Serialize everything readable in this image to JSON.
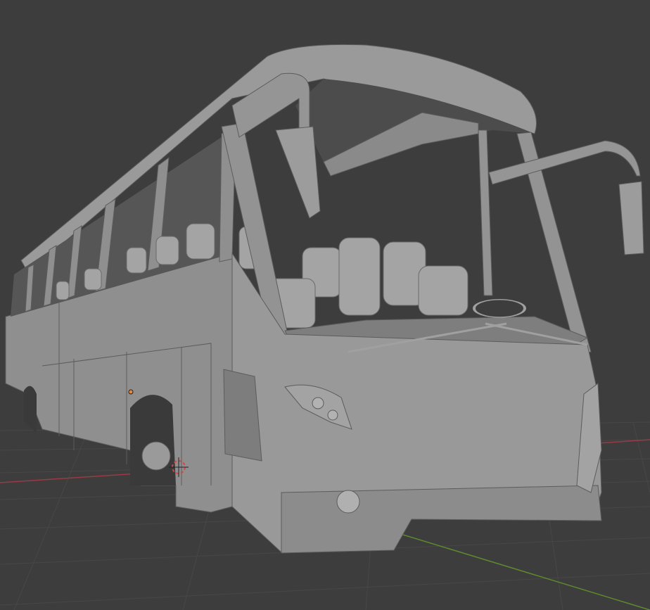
{
  "viewport": {
    "background": "#3d3d3d",
    "grid_color": "#474747",
    "x_axis_color": "#9b3a44",
    "y_axis_color": "#5f8a2e"
  },
  "model": {
    "body_color": "#8f8f8f",
    "shadow_color": "#6e6e6e",
    "highlight_color": "#a9a9a9",
    "interior_color": "#4a4a4a"
  },
  "scene_markers": {
    "origin_color": "#e8873a",
    "cursor_color": "#d64545"
  }
}
